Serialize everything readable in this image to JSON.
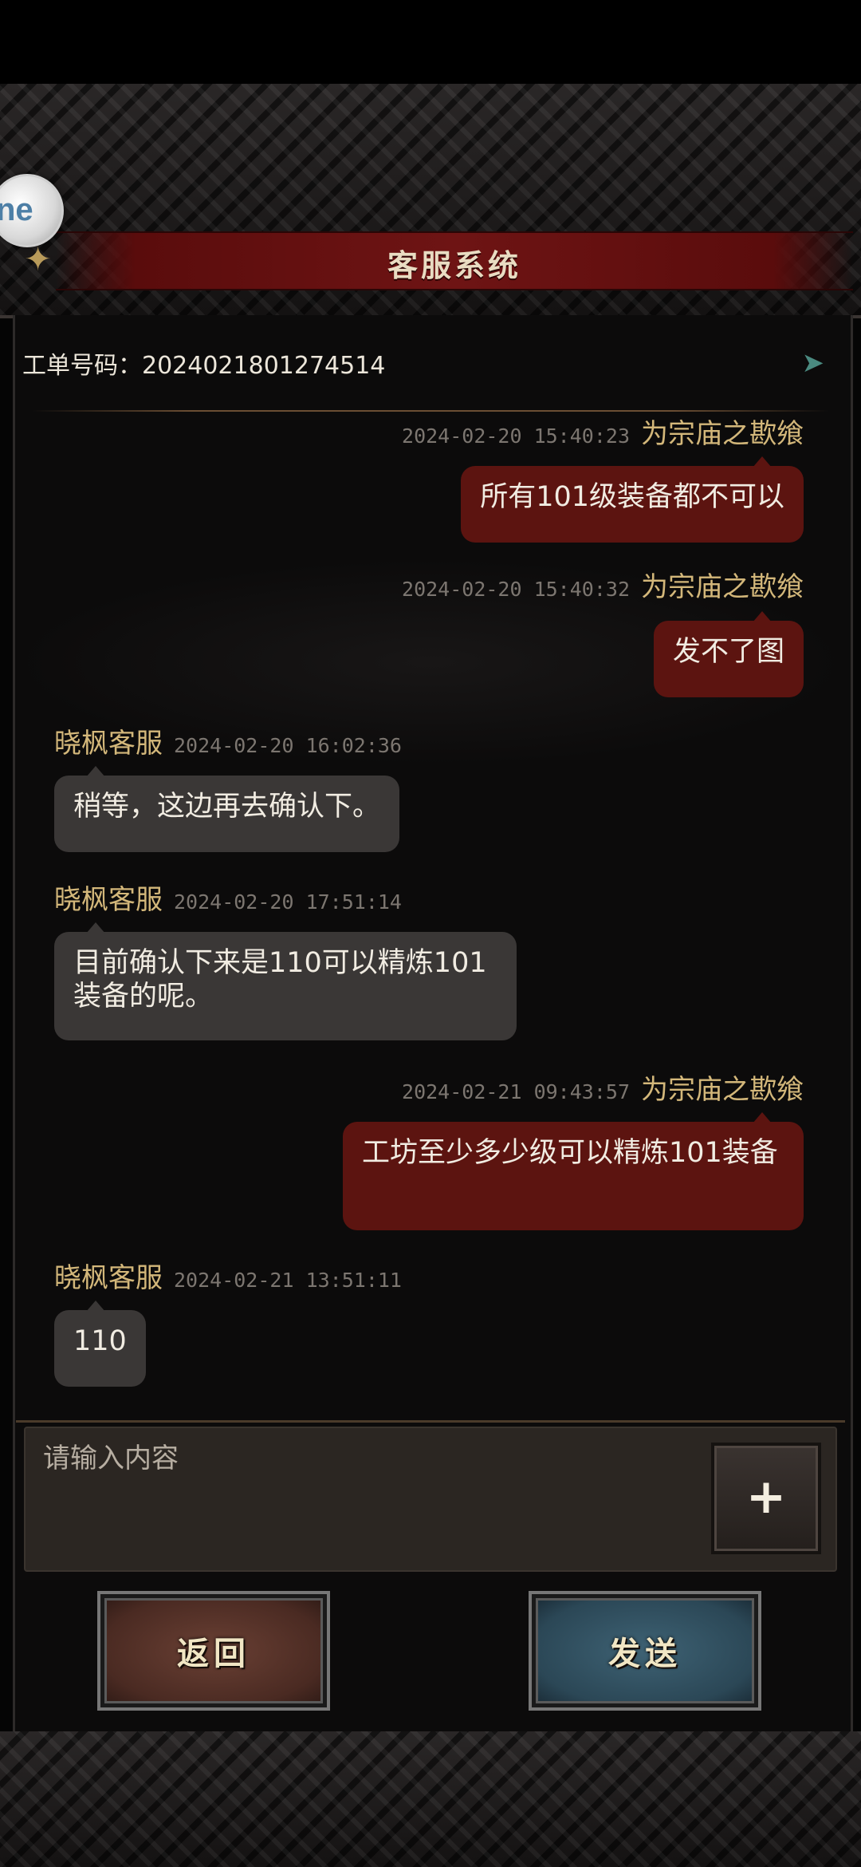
{
  "header": {
    "title": "客服系统",
    "ornament_icon": "dragon-ornament-icon",
    "overlay_icon_text": "ne"
  },
  "ticket": {
    "label": "工单号码：2024021801274514",
    "arrow_icon": "chevron-right-icon"
  },
  "messages": [
    {
      "direction": "out",
      "sender": "为宗庙之歁飨",
      "time": "2024-02-20 15:40:23",
      "text": "所有101级装备都不可以"
    },
    {
      "direction": "out",
      "sender": "为宗庙之歁飨",
      "time": "2024-02-20 15:40:32",
      "text": "发不了图"
    },
    {
      "direction": "in",
      "sender": "晓枫客服",
      "time": "2024-02-20 16:02:36",
      "text": "稍等，这边再去确认下。"
    },
    {
      "direction": "in",
      "sender": "晓枫客服",
      "time": "2024-02-20 17:51:14",
      "text": "目前确认下来是110可以精炼101装备的呢。"
    },
    {
      "direction": "out",
      "sender": "为宗庙之歁飨",
      "time": "2024-02-21 09:43:57",
      "text": "工坊至少多少级可以精炼101装备"
    },
    {
      "direction": "in",
      "sender": "晓枫客服",
      "time": "2024-02-21 13:51:11",
      "text": "110"
    }
  ],
  "input": {
    "placeholder": "请输入内容",
    "add_label": "+"
  },
  "buttons": {
    "back_label": "返回",
    "send_label": "发送"
  },
  "colors": {
    "out_bubble": "#5c1410",
    "in_bubble": "#3a3736",
    "sender_name": "#d3b77a",
    "title_banner": "#6e1414"
  }
}
